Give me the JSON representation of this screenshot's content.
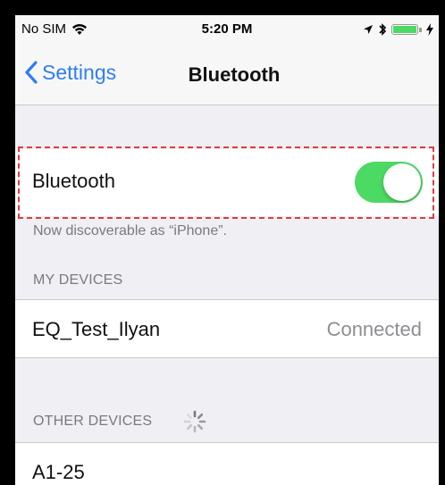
{
  "status_bar": {
    "carrier": "No SIM",
    "time": "5:20 PM",
    "icons": [
      "wifi-icon",
      "location-arrow-icon",
      "bluetooth-icon",
      "battery-icon",
      "charging-icon"
    ]
  },
  "nav": {
    "back_label": "Settings",
    "title": "Bluetooth"
  },
  "bluetooth_row": {
    "label": "Bluetooth",
    "toggle_on": true
  },
  "discoverable_note": "Now discoverable as “iPhone”.",
  "my_devices": {
    "header": "MY DEVICES",
    "items": [
      {
        "name": "EQ_Test_Ilyan",
        "status": "Connected"
      }
    ]
  },
  "other_devices": {
    "header": "OTHER DEVICES",
    "items": [
      {
        "name": "A1-25"
      }
    ]
  },
  "colors": {
    "accent": "#2f7df6",
    "toggle_on": "#4cd964",
    "highlight_border": "#e33a3a"
  }
}
